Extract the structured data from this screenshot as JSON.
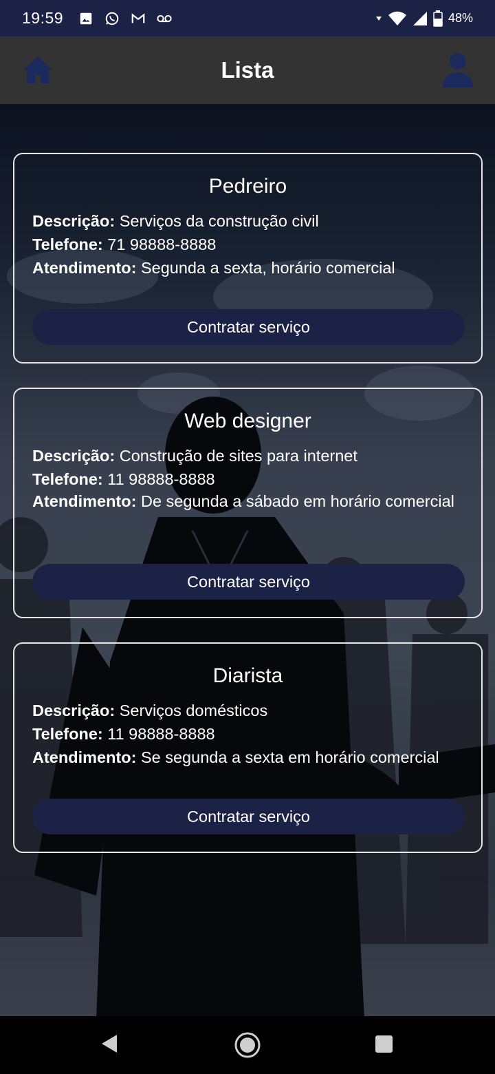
{
  "status_bar": {
    "time": "19:59",
    "battery": "48%",
    "left_icons": [
      "image-icon",
      "whatsapp-icon",
      "gmail-icon",
      "voicemail-icon"
    ],
    "right_icons": [
      "wifi-icon",
      "signal-icon",
      "battery-icon"
    ]
  },
  "app_bar": {
    "title": "Lista",
    "home_icon": "home-icon",
    "user_icon": "user-icon"
  },
  "labels": {
    "description": "Descrição:",
    "phone": "Telefone:",
    "hours": "Atendimento:"
  },
  "services": [
    {
      "title": "Pedreiro",
      "description": "Serviços da construção civil",
      "phone": "71 98888-8888",
      "hours": "Segunda a sexta, horário comercial",
      "button": "Contratar serviço"
    },
    {
      "title": "Web designer",
      "description": "Construção de sites para internet",
      "phone": "11 98888-8888",
      "hours": "De segunda a sábado em horário comercial",
      "button": "Contratar serviço"
    },
    {
      "title": "Diarista",
      "description": "Serviços domésticos",
      "phone": "11 98888-8888",
      "hours": "Se segunda a sexta em horário comercial",
      "button": "Contratar serviço"
    }
  ],
  "colors": {
    "status_bar": "#1b2246",
    "app_bar": "#333333",
    "button": "#1b2246",
    "icon_accent": "#1b2a5c"
  },
  "nav_bar": {
    "icons": [
      "back-icon",
      "home-circle-icon",
      "recents-icon"
    ]
  }
}
